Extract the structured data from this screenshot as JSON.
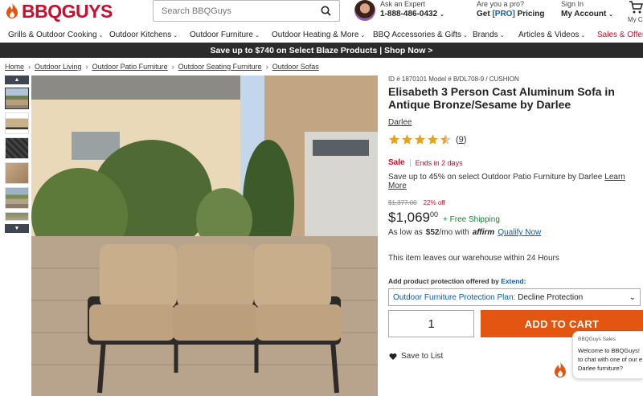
{
  "header": {
    "logo_text": "BBQGUYS",
    "search_placeholder": "Search BBQGuys",
    "expert": {
      "small": "Ask an Expert",
      "phone": "1-888-486-0432"
    },
    "pro": {
      "small": "Are you a pro?",
      "prefix": "Get ",
      "tag": "[PRO]",
      "suffix": " Pricing"
    },
    "signin": {
      "small": "Sign In",
      "label": "My Account"
    },
    "cart_label": "My Cart"
  },
  "nav": [
    "Grills & Outdoor Cooking",
    "Outdoor Kitchens",
    "Outdoor Furniture",
    "Outdoor Heating & More",
    "BBQ Accessories & Gifts",
    "Brands",
    "Articles & Videos",
    "Sales & Offers"
  ],
  "promo": "Save up to $740 on Select Blaze Products | Shop Now >",
  "breadcrumbs": [
    "Home",
    "Outdoor Living",
    "Outdoor Patio Furniture",
    "Outdoor Seating Furniture",
    "Outdoor Sofas"
  ],
  "product": {
    "ids": "ID # 1870101  Model # B/DL708-9 / CUSHION",
    "title": "Elisabeth 3 Person Cast Aluminum Sofa in Antique Bronze/Sesame by Darlee",
    "brand": "Darlee",
    "rating": 4.5,
    "review_count": "9",
    "sale": "Sale",
    "ends": "Ends in 2 days",
    "save_text": "Save up to 45% on select Outdoor Patio Furniture by Darlee",
    "learn_more": "Learn More",
    "old_price": "$1,377.00",
    "discount": "22% off",
    "price_main": "$1,069",
    "price_cents": "00",
    "shipping": "+ Free Shipping",
    "affirm_prefix": "As low as",
    "affirm_amount": "$52",
    "affirm_suffix": "/mo with",
    "affirm_logo": "affirm",
    "affirm_link": "Qualify Now",
    "leaves": "This item leaves our warehouse within 24 Hours",
    "protect_label": "Add product protection offered by",
    "protect_brand": "Extend",
    "protect_plan_label": "Outdoor Furniture Protection Plan:",
    "protect_plan_value": "Decline Protection",
    "quantity": "1",
    "add_to_cart": "ADD TO CART",
    "save_to_list": "Save to List"
  },
  "chat": {
    "from": "BBQGuys Sales",
    "lines": [
      "Welcome to BBQGuys!",
      "to chat with one of our e",
      "Darlee furniture?"
    ]
  },
  "colors": {
    "brand_red": "#c8102e",
    "cta_orange": "#e35612",
    "promo_bg": "#2b2b2b",
    "link_blue": "#0b5cad"
  }
}
